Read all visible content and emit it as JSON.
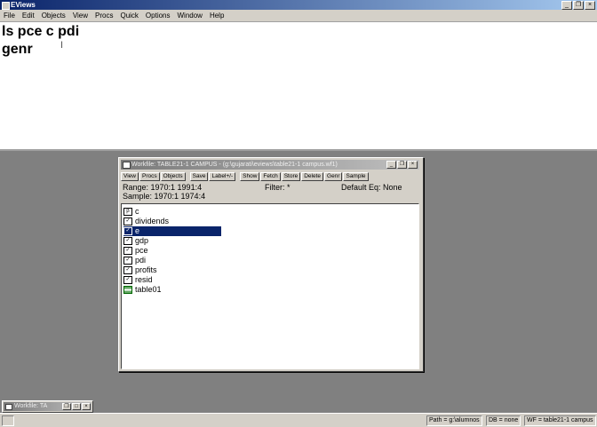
{
  "app": {
    "title": "EViews"
  },
  "window_controls": {
    "minimize": "_",
    "restore": "❐",
    "close": "×"
  },
  "menu": [
    "File",
    "Edit",
    "Objects",
    "View",
    "Procs",
    "Quick",
    "Options",
    "Window",
    "Help"
  ],
  "command": {
    "lines": [
      "ls pce c pdi",
      "genr"
    ]
  },
  "workfile": {
    "title": "Workfile: TABLE21-1 CAMPUS - (g:\\gujarati\\eviews\\table21-1 campus.wf1)",
    "toolbar": [
      "View",
      "Procs",
      "Objects",
      "Save",
      "Label+/-",
      "Show",
      "Fetch",
      "Store",
      "Delete",
      "Genr",
      "Sample"
    ],
    "range": "Range:  1970:1 1991:4",
    "sample": "Sample: 1970:1 1974:4",
    "filter": "Filter: *",
    "default_eq": "Default Eq: None",
    "objects": [
      {
        "name": "c",
        "icon": "coef-icon"
      },
      {
        "name": "dividends",
        "icon": "series-icon"
      },
      {
        "name": "e",
        "icon": "series-icon",
        "selected": true
      },
      {
        "name": "gdp",
        "icon": "series-icon"
      },
      {
        "name": "pce",
        "icon": "series-icon"
      },
      {
        "name": "pdi",
        "icon": "series-icon"
      },
      {
        "name": "profits",
        "icon": "series-icon"
      },
      {
        "name": "resid",
        "icon": "series-icon"
      },
      {
        "name": "table01",
        "icon": "table-icon"
      }
    ]
  },
  "minimized": {
    "title": "Workfile: TA"
  },
  "status": {
    "path": "Path = g:\\alumnos",
    "db": "DB = none",
    "wf": "WF = table21-1 campus"
  }
}
